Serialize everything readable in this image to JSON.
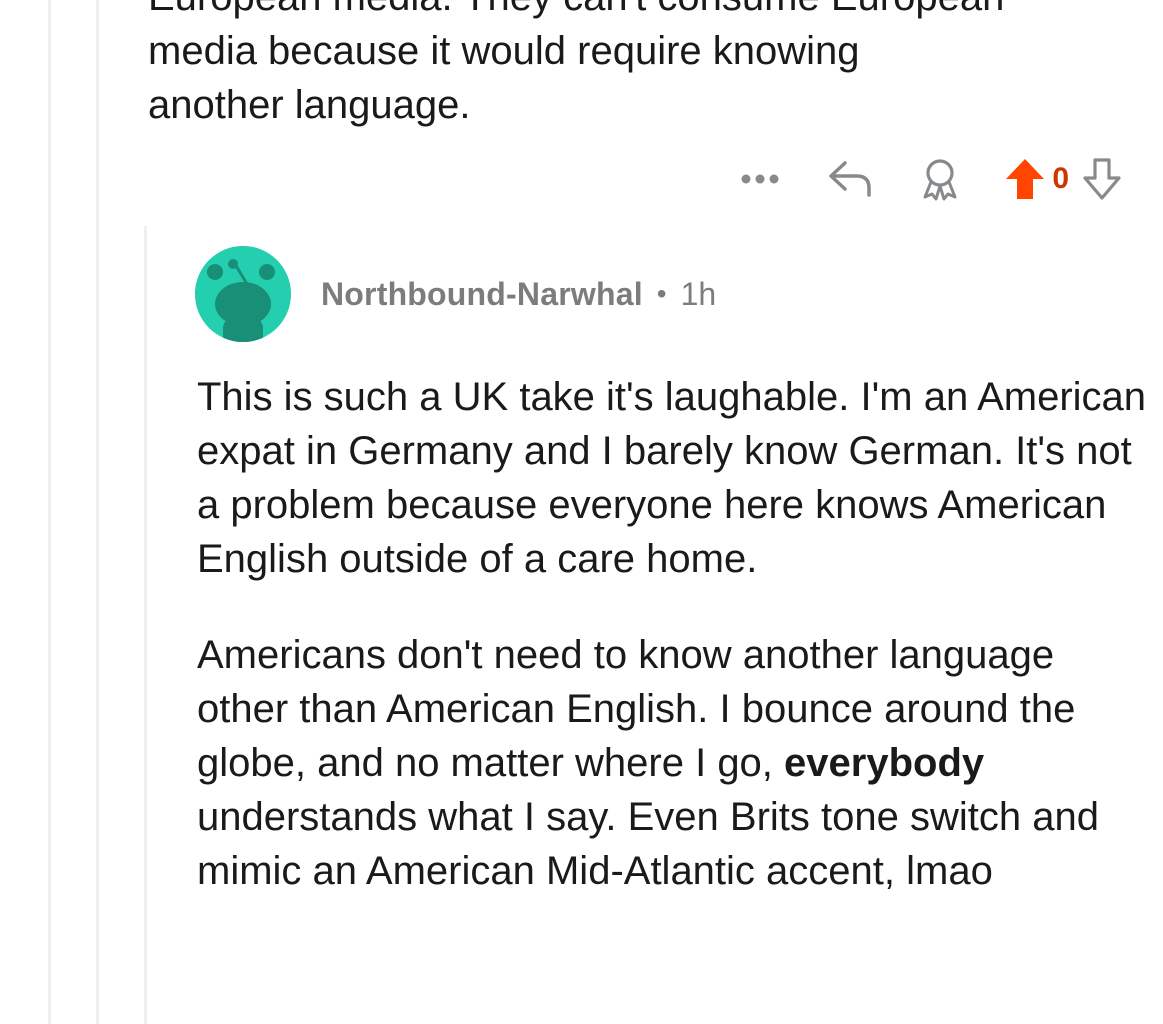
{
  "parent_comment": {
    "body_lines": [
      "European media. They can't consume European",
      "media because it would require knowing",
      "another language."
    ],
    "vote_count": "0"
  },
  "icons": {
    "more": "more-options-icon",
    "reply": "reply-arrow-icon",
    "award": "award-icon",
    "upvote": "upvote-arrow-icon",
    "downvote": "downvote-arrow-icon"
  },
  "reply_comment": {
    "author": "Northbound-Narwhal",
    "separator": "•",
    "age": "1h",
    "paragraph_1": "This is such a UK take it's laughable. I'm an American expat in Germany and I barely know German. It's not a problem because everyone here knows American English outside of a care home.",
    "paragraph_2_before": "Americans don't need to know another language other than American English. I bounce around the globe, and no matter where I go, ",
    "paragraph_2_bold": "everybody",
    "paragraph_2_after": " understands what I say. Even Brits tone switch and mimic an American Mid-Atlantic accent, lmao"
  },
  "colors": {
    "upvote_active": "#ff4500",
    "vote_count": "#cc3700",
    "avatar_bg": "#24cfb0",
    "meta_text": "#7c7c7c",
    "thread_line": "#edeff1"
  }
}
